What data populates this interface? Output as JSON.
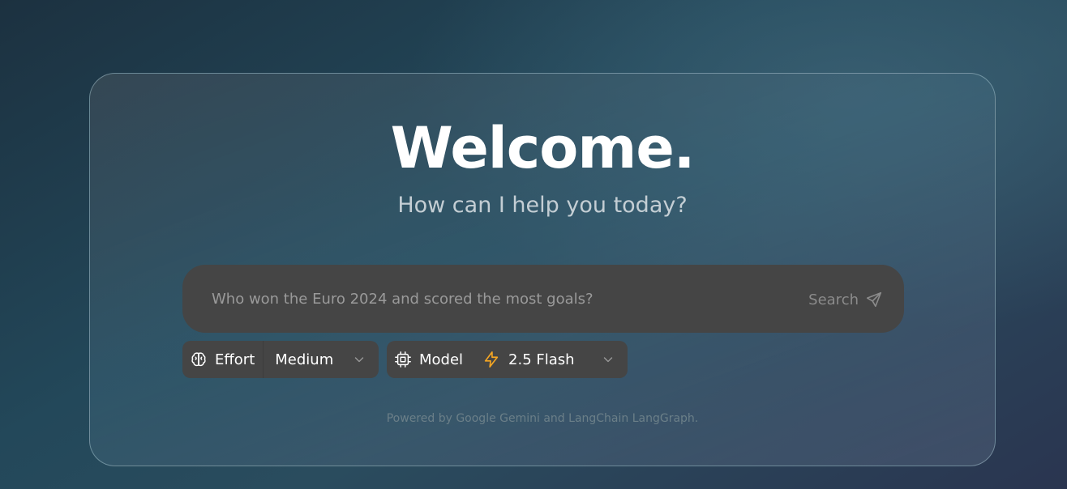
{
  "welcome": {
    "title": "Welcome.",
    "subtitle": "How can I help you today?"
  },
  "search": {
    "placeholder": "Who won the Euro 2024 and scored the most goals?",
    "button_label": "Search",
    "button_icon": "send-icon"
  },
  "effort": {
    "icon": "brain-icon",
    "label": "Effort",
    "selected": "Medium"
  },
  "model": {
    "icon": "cpu-icon",
    "label": "Model",
    "selected_icon": "zap-icon",
    "selected": "2.5 Flash",
    "accent_color": "#f5a623"
  },
  "footer": {
    "text": "Powered by Google Gemini and LangChain LangGraph."
  }
}
